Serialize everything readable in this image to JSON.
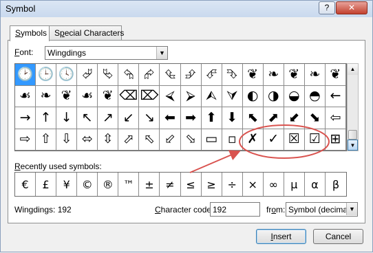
{
  "window": {
    "title": "Symbol",
    "help_label": "?",
    "close_label": "✕"
  },
  "tabs": [
    {
      "label_u": "S",
      "label_rest": "ymbols",
      "active": true
    },
    {
      "label_pre": "S",
      "label_u": "p",
      "label_rest": "ecial Characters",
      "active": false
    }
  ],
  "font": {
    "label_u": "F",
    "label_rest": "ont:",
    "value": "Wingdings"
  },
  "symbol_grid": [
    [
      "🕑",
      "🕒",
      "🕓",
      "⮰",
      "⮱",
      "⮲",
      "⮳",
      "⮴",
      "⮵",
      "⮶",
      "⮷",
      "❦",
      "❧",
      "❦",
      "❧",
      "❦"
    ],
    [
      "☙",
      "❧",
      "❦",
      "☙",
      "❦",
      "⌫",
      "⌦",
      "⮘",
      "⮚",
      "⮙",
      "⮛",
      "◐",
      "◑",
      "◒",
      "◓",
      "←"
    ],
    [
      "→",
      "↑",
      "↓",
      "↖",
      "↗",
      "↙",
      "↘",
      "⬅",
      "➡",
      "⬆",
      "⬇",
      "⬉",
      "⬈",
      "⬋",
      "⬊",
      "⇦"
    ],
    [
      "⇨",
      "⇧",
      "⇩",
      "⬄",
      "⇳",
      "⬀",
      "⬁",
      "⬃",
      "⬂",
      "▭",
      "▫",
      "✗",
      "✓",
      "☒",
      "☑",
      "⊞"
    ]
  ],
  "selected_cell": "symbol_grid.0.0",
  "recent": {
    "label_u": "R",
    "label_rest": "ecently used symbols:",
    "symbols": [
      "€",
      "£",
      "¥",
      "©",
      "®",
      "™",
      "±",
      "≠",
      "≤",
      "≥",
      "÷",
      "×",
      "∞",
      "µ",
      "α",
      "β"
    ]
  },
  "status": {
    "font_info": "Wingdings: 192"
  },
  "character_code": {
    "label_u": "C",
    "label_rest": "haracter code:",
    "value": "192"
  },
  "from": {
    "label_pre": "fr",
    "label_u": "o",
    "label_rest": "m:",
    "value": "Symbol (decimal)"
  },
  "buttons": {
    "insert_u": "I",
    "insert_rest": "nsert",
    "cancel": "Cancel"
  },
  "colors": {
    "selection": "#3399ff",
    "annotation": "#d9534f"
  }
}
